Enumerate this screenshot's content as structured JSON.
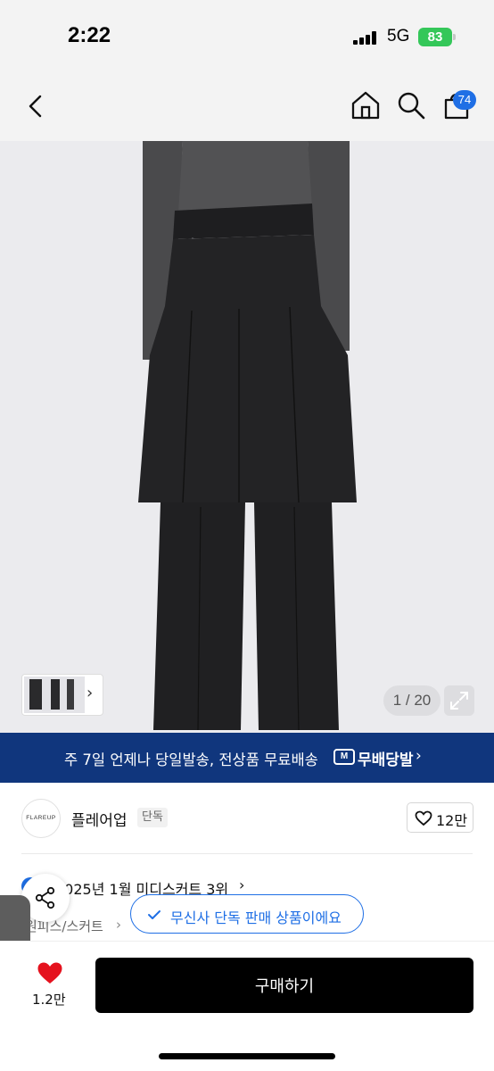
{
  "status_bar": {
    "time": "2:22",
    "network": "5G",
    "battery": "83"
  },
  "nav": {
    "cart_count": "74"
  },
  "gallery": {
    "page_indicator": "1 / 20"
  },
  "banner": {
    "text": "주 7일 언제나 당일발송, 전상품 무료배송",
    "logo_box": "M",
    "logo_text": "무배당발"
  },
  "brand": {
    "logo_text": "FLAREUP",
    "name": "플레어업",
    "tag": "단독",
    "like_count": "12만"
  },
  "ranking": {
    "text": "2025년 1월 미디스커트 3위"
  },
  "category": {
    "text": "원피스/스커트"
  },
  "toast": {
    "text": "무신사 단독 판매 상품이에요"
  },
  "bottom_bar": {
    "like_total": "1.2만",
    "buy_label": "구매하기"
  },
  "colors": {
    "accent": "#1f6fe5",
    "banner_bg": "#10367d",
    "heart": "#e5121e",
    "buy_bg": "#000000"
  },
  "icons": [
    "back-icon",
    "home-icon",
    "search-icon",
    "cart-icon",
    "chevron-right-icon",
    "expand-icon",
    "heart-outline-icon",
    "heart-filled-icon",
    "share-icon",
    "check-icon"
  ]
}
